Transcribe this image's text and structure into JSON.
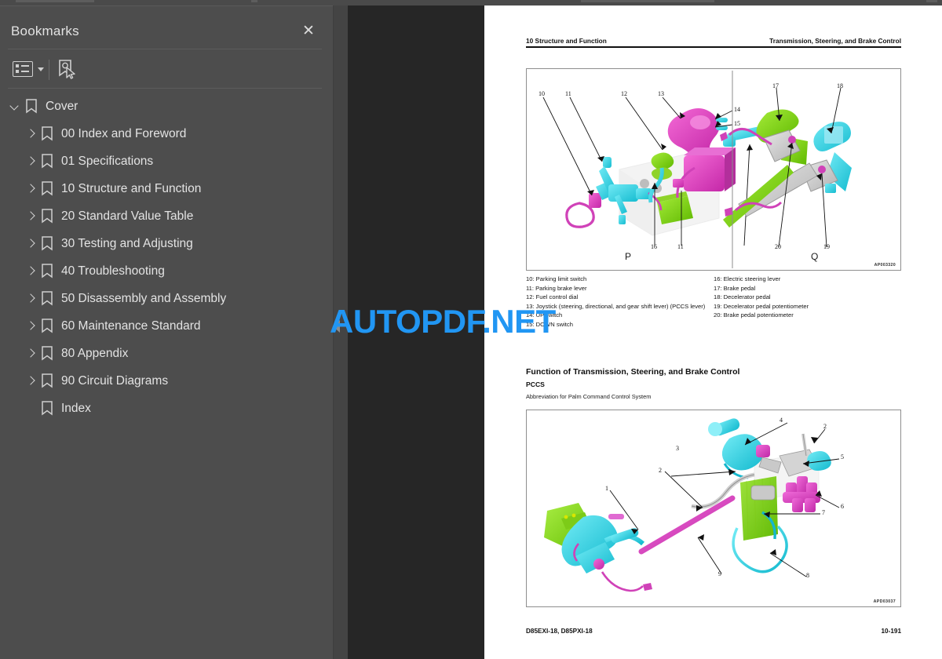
{
  "sidebar": {
    "title": "Bookmarks",
    "close_label": "✕",
    "toolbar": {
      "list_options_icon": "list-options-icon",
      "caret_icon": "chevron-down-icon",
      "new_bookmark_icon": "bookmark-cursor-icon"
    },
    "items": [
      {
        "label": "Cover",
        "level": 0,
        "expanded": true,
        "has_children": true
      },
      {
        "label": "00 Index and Foreword",
        "level": 1,
        "expanded": false,
        "has_children": true
      },
      {
        "label": "01 Specifications",
        "level": 1,
        "expanded": false,
        "has_children": true
      },
      {
        "label": "10 Structure and Function",
        "level": 1,
        "expanded": false,
        "has_children": true
      },
      {
        "label": "20 Standard Value Table",
        "level": 1,
        "expanded": false,
        "has_children": true
      },
      {
        "label": "30 Testing and Adjusting",
        "level": 1,
        "expanded": false,
        "has_children": true
      },
      {
        "label": "40 Troubleshooting",
        "level": 1,
        "expanded": false,
        "has_children": true
      },
      {
        "label": "50 Disassembly and Assembly",
        "level": 1,
        "expanded": false,
        "has_children": true
      },
      {
        "label": "60 Maintenance Standard",
        "level": 1,
        "expanded": false,
        "has_children": true
      },
      {
        "label": "80 Appendix",
        "level": 1,
        "expanded": false,
        "has_children": true
      },
      {
        "label": "90 Circuit Diagrams",
        "level": 1,
        "expanded": false,
        "has_children": true
      },
      {
        "label": "Index",
        "level": 1,
        "expanded": false,
        "has_children": false
      }
    ]
  },
  "watermark": {
    "text": "AUTOPDF.NET",
    "color": "#2196f3"
  },
  "page": {
    "header_left": "10 Structure and Function",
    "header_right": "Transmission, Steering, and Brake Control",
    "footer_left": "D85EXI-18, D85PXI-18",
    "footer_right": "10-191",
    "section_title": "Function of Transmission, Steering, and Brake Control",
    "sub_title": "PCCS",
    "sub_note": "Abbreviation for Palm Command Control System",
    "figure_top": {
      "code": "AP003320",
      "view_left": "P",
      "view_right": "Q",
      "callouts_left": [
        "10",
        "11",
        "12",
        "13",
        "14",
        "15",
        "16",
        "11"
      ],
      "callouts_right": [
        "17",
        "18",
        "19",
        "20"
      ]
    },
    "figure_bottom": {
      "code": "APD03037",
      "callouts": [
        "1",
        "2",
        "2",
        "3",
        "4",
        "5",
        "6",
        "7",
        "8",
        "9"
      ]
    },
    "legend_left": [
      "10: Parking limit switch",
      "11: Parking brake lever",
      "12: Fuel control dial",
      "13: Joystick (steering, directional, and gear shift lever) (PCCS lever)",
      "14: UP switch",
      "15: DOWN switch"
    ],
    "legend_right": [
      "16: Electric steering lever",
      "17: Brake pedal",
      "18: Decelerator pedal",
      "19: Decelerator pedal potentiometer",
      "20: Brake pedal potentiometer"
    ]
  }
}
